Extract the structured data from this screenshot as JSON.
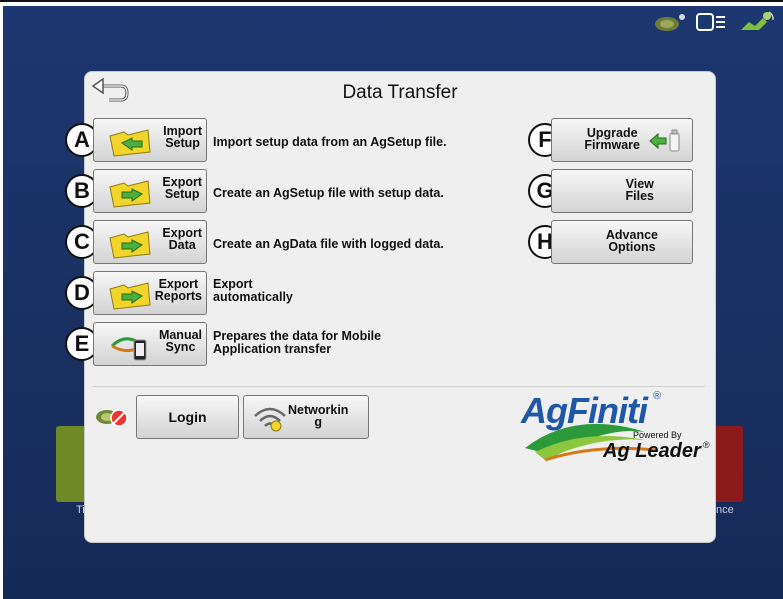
{
  "title": "Data Transfer",
  "buttons": [
    {
      "letter": "A",
      "line1": "Import",
      "line2": "Setup",
      "desc": "Import setup data from an AgSetup file."
    },
    {
      "letter": "B",
      "line1": "Export",
      "line2": "Setup",
      "desc": "Create an AgSetup file with setup data."
    },
    {
      "letter": "C",
      "line1": "Export",
      "line2": "Data",
      "desc": "Create an AgData file with logged data."
    },
    {
      "letter": "D",
      "line1": "Export",
      "line2": "Reports",
      "desc_line1": "Export",
      "desc_line2": "automatically"
    },
    {
      "letter": "E",
      "line1": "Manual",
      "line2": "Sync",
      "desc_line1": "Prepares the data for Mobile",
      "desc_line2": "Application transfer"
    }
  ],
  "right_buttons": [
    {
      "letter": "F",
      "line1": "Upgrade",
      "line2": "Firmware"
    },
    {
      "letter": "G",
      "line1": "View",
      "line2": "Files"
    },
    {
      "letter": "H",
      "line1": "Advance",
      "line2": "Options"
    }
  ],
  "login_label": "Login",
  "networking_line1": "Networkin",
  "networking_line2": "g",
  "brand": {
    "name": "AgFiniti",
    "registered": "®",
    "powered_by": "Powered By",
    "company": "Ag Leader",
    "company_reg": "®"
  },
  "background": {
    "left_tile_text": "Ti",
    "right_tile_text": "nce"
  },
  "colors": {
    "screen": "#1a3265",
    "panel": "#efefef",
    "arrow_green": "#4caf3e",
    "folder_yellow": "#f1d52a",
    "brand_blue": "#1f56a6"
  },
  "icons": [
    "back-arrow-icon",
    "folder-arrow-icon",
    "firmware-usb-icon",
    "sync-phone-icon",
    "agfiniti-no-connection-icon",
    "wifi-key-icon",
    "gps-antenna-icon",
    "display-icon",
    "satellite-icon"
  ]
}
